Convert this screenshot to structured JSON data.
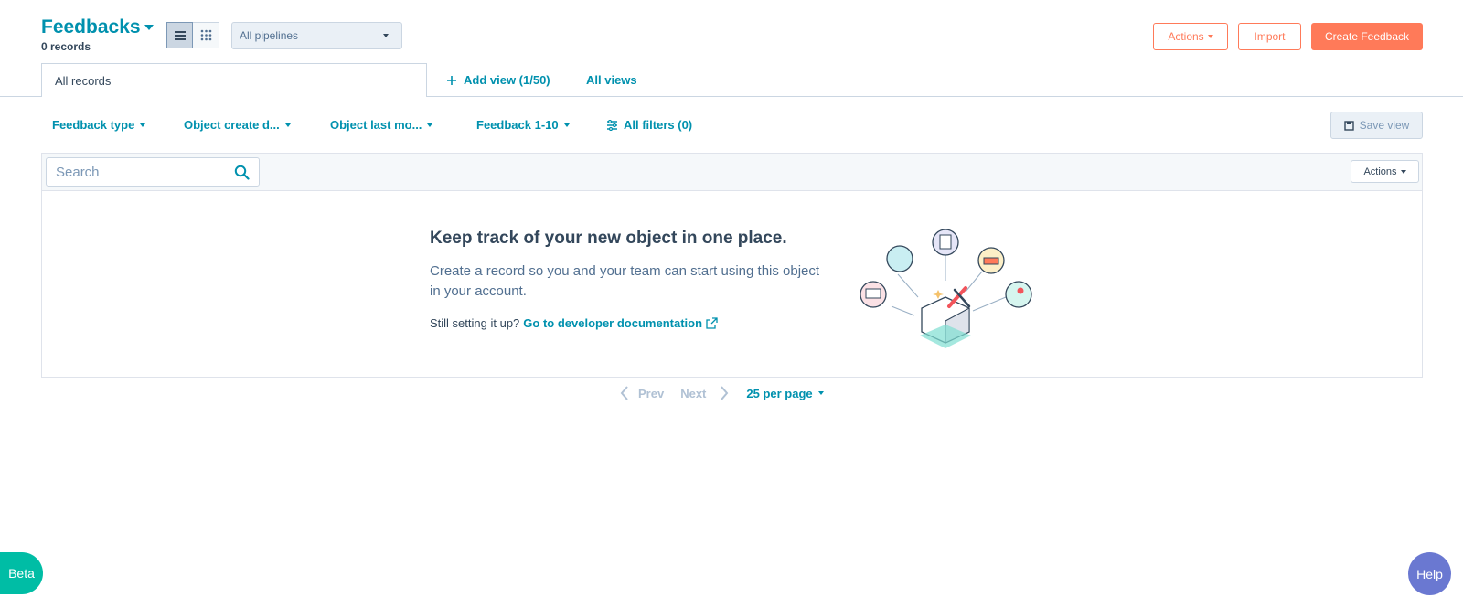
{
  "header": {
    "title": "Feedbacks",
    "record_count": "0 records",
    "pipeline_select": "All pipelines",
    "actions_label": "Actions",
    "import_label": "Import",
    "create_label": "Create Feedback"
  },
  "tabs": {
    "current": "All records",
    "add_view": "Add view (1/50)",
    "all_views": "All views"
  },
  "filters": [
    {
      "label": "Feedback type"
    },
    {
      "label": "Object create d..."
    },
    {
      "label": "Object last mo..."
    },
    {
      "label": "Feedback 1-10"
    },
    {
      "label": "All filters (0)"
    }
  ],
  "save_view": "Save view",
  "table": {
    "search_placeholder": "Search",
    "actions_label": "Actions"
  },
  "empty_state": {
    "heading": "Keep track of your new object in one place.",
    "body": "Create a record so you and your team can start using this object in your account.",
    "prompt": "Still setting it up?",
    "link": "Go to developer documentation"
  },
  "pagination": {
    "prev": "Prev",
    "next": "Next",
    "per_page": "25 per page"
  },
  "floating": {
    "beta": "Beta",
    "help": "Help"
  },
  "colors": {
    "accent": "#0091ae",
    "primary": "#ff7a59",
    "beta": "#00bda5",
    "help": "#6a78d1"
  }
}
